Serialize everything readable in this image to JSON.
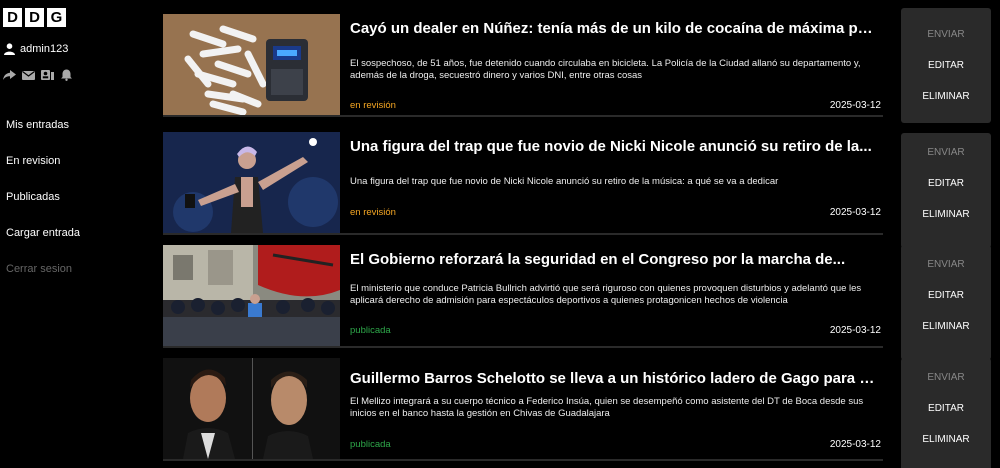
{
  "logo": [
    "D",
    "D",
    "G"
  ],
  "user": {
    "name": "admin123"
  },
  "toolbar_icons": [
    "share-icon",
    "mail-icon",
    "contacts-icon",
    "bell-icon"
  ],
  "nav": [
    {
      "label": "Mis entradas"
    },
    {
      "label": "En revision"
    },
    {
      "label": "Publicadas"
    },
    {
      "label": "Cargar entrada"
    },
    {
      "label": "Cerrar sesion"
    }
  ],
  "colors": {
    "review": "#f5a623",
    "published": "#2ea84a",
    "panel": "#2a2a2a"
  },
  "actions": {
    "send": "ENVIAR",
    "edit": "EDITAR",
    "delete": "ELIMINAR"
  },
  "posts": [
    {
      "title": "Cayó un dealer en Núñez: tenía más de un kilo de cocaína de máxima pureza",
      "excerpt": "El sospechoso, de 51 años, fue detenido cuando circulaba en bicicleta. La Policía de la Ciudad allanó su departamento y, además de la droga, secuestró dinero y varios DNI, entre otras cosas",
      "status": "en revisión",
      "date": "2025-03-12"
    },
    {
      "title": "Una figura del trap que fue novio de Nicki Nicole anunció su retiro de la...",
      "excerpt": "Una figura del trap que fue novio de Nicki Nicole anunció su retiro de la música: a qué se va a dedicar",
      "status": "en revisión",
      "date": "2025-03-12"
    },
    {
      "title": "El Gobierno reforzará la seguridad en el Congreso por la marcha de...",
      "excerpt": "El ministerio que conduce Patricia Bullrich advirtió que será riguroso con quienes provoquen disturbios y adelantó que les aplicará derecho de admisión para espectáculos deportivos a quienes protagonicen hechos de violencia",
      "status": "publicada",
      "date": "2025-03-12"
    },
    {
      "title": "Guillermo Barros Schelotto se lleva a un histórico ladero de Gago para su...",
      "excerpt": "El Mellizo integrará a su cuerpo técnico a Federico Insúa, quien se desempeñó como asistente del DT de Boca desde sus inicios en el banco hasta la gestión en Chivas de Guadalajara",
      "status": "publicada",
      "date": "2025-03-12"
    }
  ]
}
